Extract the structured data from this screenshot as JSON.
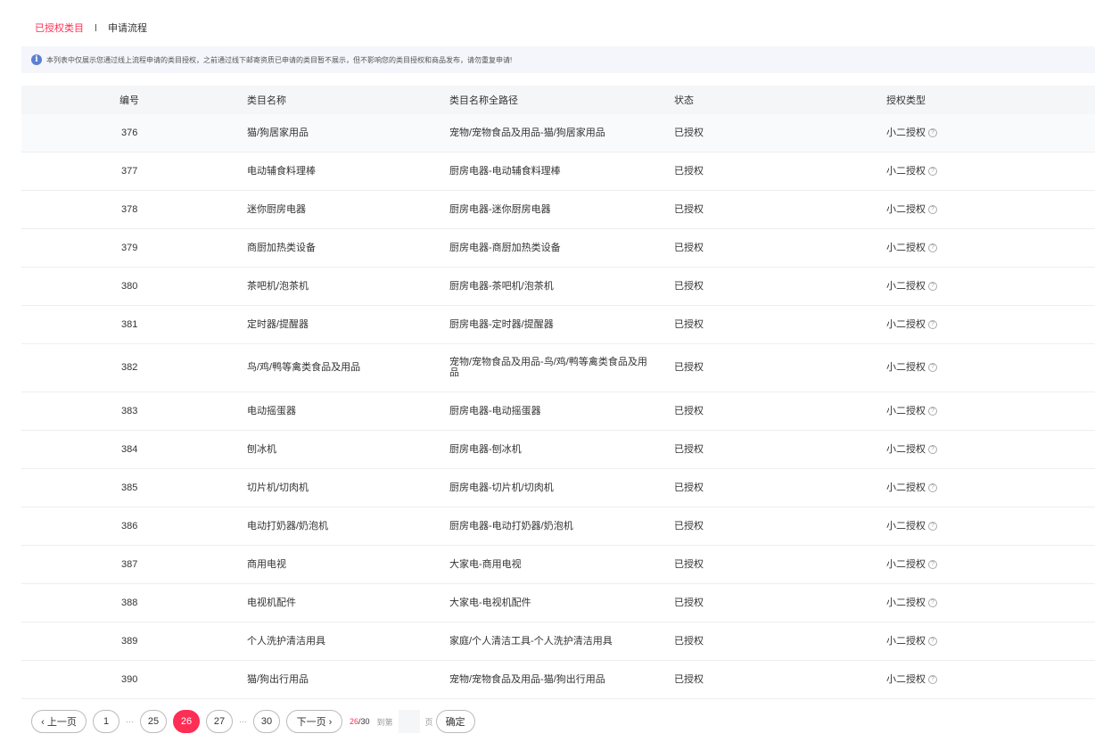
{
  "tabs": [
    {
      "label": "已授权类目",
      "active": true
    },
    {
      "label": "申请流程",
      "active": false
    }
  ],
  "notice": "本列表中仅展示您通过线上流程申请的类目授权，之前通过线下邮寄资质已申请的类目暂不展示，但不影响您的类目授权和商品发布，请勿重复申请!",
  "table": {
    "headers": [
      "编号",
      "类目名称",
      "类目名称全路径",
      "状态",
      "授权类型"
    ],
    "rows": [
      {
        "id": "376",
        "name": "猫/狗居家用品",
        "path": "宠物/宠物食品及用品-猫/狗居家用品",
        "status": "已授权",
        "type": "小二授权"
      },
      {
        "id": "377",
        "name": "电动辅食料理棒",
        "path": "厨房电器-电动辅食料理棒",
        "status": "已授权",
        "type": "小二授权"
      },
      {
        "id": "378",
        "name": "迷你厨房电器",
        "path": "厨房电器-迷你厨房电器",
        "status": "已授权",
        "type": "小二授权"
      },
      {
        "id": "379",
        "name": "商厨加热类设备",
        "path": "厨房电器-商厨加热类设备",
        "status": "已授权",
        "type": "小二授权"
      },
      {
        "id": "380",
        "name": "茶吧机/泡茶机",
        "path": "厨房电器-茶吧机/泡茶机",
        "status": "已授权",
        "type": "小二授权"
      },
      {
        "id": "381",
        "name": "定时器/提醒器",
        "path": "厨房电器-定时器/提醒器",
        "status": "已授权",
        "type": "小二授权"
      },
      {
        "id": "382",
        "name": "鸟/鸡/鸭等禽类食品及用品",
        "path": "宠物/宠物食品及用品-鸟/鸡/鸭等禽类食品及用品",
        "status": "已授权",
        "type": "小二授权"
      },
      {
        "id": "383",
        "name": "电动摇蛋器",
        "path": "厨房电器-电动摇蛋器",
        "status": "已授权",
        "type": "小二授权"
      },
      {
        "id": "384",
        "name": "刨冰机",
        "path": "厨房电器-刨冰机",
        "status": "已授权",
        "type": "小二授权"
      },
      {
        "id": "385",
        "name": "切片机/切肉机",
        "path": "厨房电器-切片机/切肉机",
        "status": "已授权",
        "type": "小二授权"
      },
      {
        "id": "386",
        "name": "电动打奶器/奶泡机",
        "path": "厨房电器-电动打奶器/奶泡机",
        "status": "已授权",
        "type": "小二授权"
      },
      {
        "id": "387",
        "name": "商用电视",
        "path": "大家电-商用电视",
        "status": "已授权",
        "type": "小二授权"
      },
      {
        "id": "388",
        "name": "电视机配件",
        "path": "大家电-电视机配件",
        "status": "已授权",
        "type": "小二授权"
      },
      {
        "id": "389",
        "name": "个人洗护清洁用具",
        "path": "家庭/个人清洁工具-个人洗护清洁用具",
        "status": "已授权",
        "type": "小二授权"
      },
      {
        "id": "390",
        "name": "猫/狗出行用品",
        "path": "宠物/宠物食品及用品-猫/狗出行用品",
        "status": "已授权",
        "type": "小二授权"
      }
    ]
  },
  "pagination": {
    "prev": "‹ 上一页",
    "next": "下一页 ›",
    "pages": [
      "1",
      "25",
      "26",
      "27",
      "30"
    ],
    "ellipsis": "···",
    "current": "26",
    "total_sep": "/30",
    "goto_prefix": "到第",
    "goto_suffix": "页",
    "goto_value": "",
    "confirm": "确定"
  },
  "colors": {
    "accent": "#ff2e54",
    "notice_bg": "#f4f6fb",
    "info_icon": "#5b7fcf"
  }
}
